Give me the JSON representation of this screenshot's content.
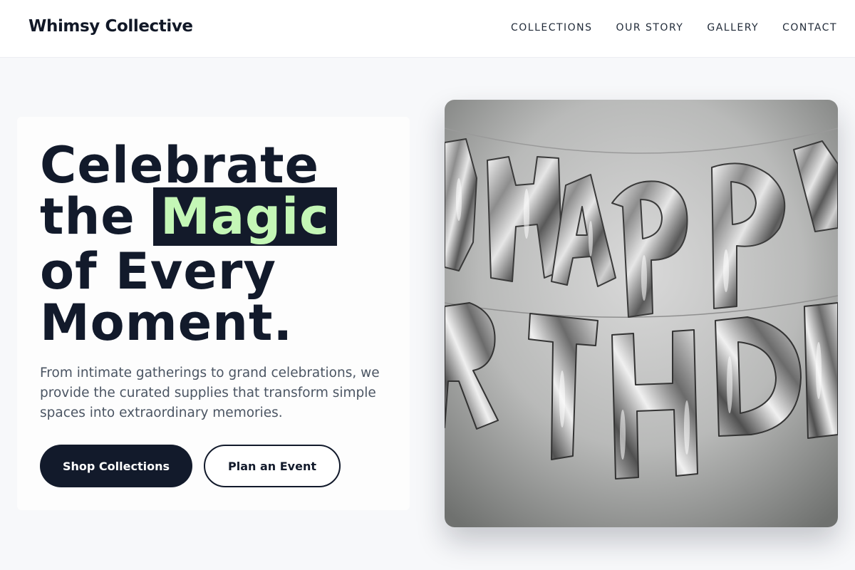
{
  "header": {
    "brand": "Whimsy Collective",
    "nav": [
      {
        "label": "COLLECTIONS"
      },
      {
        "label": "OUR STORY"
      },
      {
        "label": "GALLERY"
      },
      {
        "label": "CONTACT"
      }
    ]
  },
  "hero": {
    "headline": {
      "line1": "Celebrate",
      "line2_prefix": "the ",
      "highlight": "Magic",
      "line3": "of Every",
      "line4": "Moment."
    },
    "description": "From intimate gatherings to grand celebrations, we provide the curated supplies that transform simple spaces into extraordinary memories.",
    "primary_button": "Shop Collections",
    "secondary_button": "Plan an Event",
    "image": {
      "subject": "Silver foil balloon letters spelling happy birthday"
    }
  },
  "colors": {
    "ink": "#121a2b",
    "highlight_text": "#c4f7b6",
    "body_text": "#4b5563",
    "page_bg": "#f7f8fa"
  }
}
